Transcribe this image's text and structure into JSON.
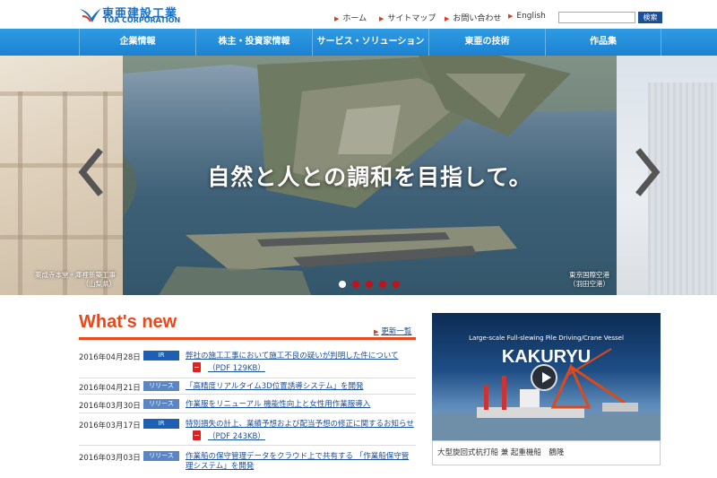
{
  "header": {
    "logo_jp": "東亜建設工業",
    "logo_en": "TOA CORPORATION",
    "util_nav": [
      "ホーム",
      "サイトマップ",
      "お問い合わせ",
      "English"
    ],
    "search_button": "検索"
  },
  "gnav": [
    "企業情報",
    "株主・投資家情報",
    "サービス・ソリューション",
    "東亜の技術",
    "作品集"
  ],
  "hero": {
    "headline": "自然と人との調和を目指して。",
    "caption_left_1": "薬成寺本堂・庫裡新築工事",
    "caption_left_2": "（山梨県）",
    "caption_main_1": "東京国際空港",
    "caption_main_2": "（羽田空港）",
    "slide_count": 5,
    "active_slide": 1
  },
  "whats_new": {
    "title": "What's new",
    "list_link": "更新一覧",
    "items": [
      {
        "date": "2016年04月28日",
        "tag": "IR",
        "tag_type": "ir",
        "text": "弊社の施工工事において施工不良の疑いが判明した件について",
        "pdf": "（PDF 129KB）"
      },
      {
        "date": "2016年04月21日",
        "tag": "リリース",
        "tag_type": "release",
        "text": "「高精度リアルタイム3D位置誘導システム」を開発",
        "pdf": ""
      },
      {
        "date": "2016年03月30日",
        "tag": "リリース",
        "tag_type": "release",
        "text": "作業服をリニューアル 機能性向上と女性用作業服導入",
        "pdf": ""
      },
      {
        "date": "2016年03月17日",
        "tag": "IR",
        "tag_type": "ir",
        "text": "特別損失の計上、業績予想および配当予想の修正に関するお知らせ",
        "pdf": "（PDF 243KB）"
      },
      {
        "date": "2016年03月03日",
        "tag": "リリース",
        "tag_type": "release",
        "text": "作業船の保守管理データをクラウド上で共有する 「作業船保守管理システム」を開発",
        "pdf": ""
      }
    ]
  },
  "video": {
    "subtitle": "Large-scale Full-slewing Pile Driving/Crane Vessel",
    "title": "KAKURYU",
    "caption": "大型旋回式杭打船 兼 起重機船　鶴隆"
  },
  "colors": {
    "nav_blue": "#1b82d2",
    "accent_red": "#e8491c",
    "link_blue": "#1a4f9c"
  }
}
